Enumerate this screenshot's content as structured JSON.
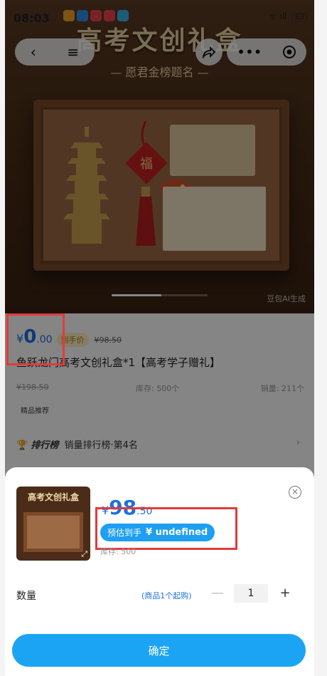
{
  "status_bar": {
    "time": "08:03",
    "battery": "83"
  },
  "hero": {
    "title": "高考文创礼盒",
    "subtitle": "— 愿君金榜题名 —",
    "ai_label": "豆包AI生成"
  },
  "nav": {
    "back_icon": "back-arrow-icon",
    "menu_icon": "menu-icon",
    "share_icon": "share-icon",
    "more_icon": "more-icon",
    "target_icon": "record-icon"
  },
  "product": {
    "price_symbol": "¥",
    "price_int": "0",
    "price_dec": ".00",
    "final_tag": "到手价",
    "old_price": "¥98.50",
    "title": "鱼跃龙门高考文创礼盒*1【高考学子赠礼】",
    "original_price": "¥198.50",
    "stock": "库存: 500个",
    "sales": "销量: 211个",
    "recommend": "精品推荐",
    "rank_brand": "排行榜",
    "rank_text": "销量排行榜·第4名",
    "rank_arrow": "›"
  },
  "sheet": {
    "thumb_title": "高考文创礼盒",
    "price_symbol": "¥",
    "price_int": "98",
    "price_dec": ".50",
    "est_label": "预估到手",
    "est_value": "¥ undefined",
    "stock": "库存: 500",
    "qty_label": "数量",
    "qty_note": "(商品1个起购)",
    "qty_minus": "—",
    "qty_value": "1",
    "qty_plus": "+",
    "confirm_label": "确定",
    "close_label": "×"
  },
  "colors": {
    "accent": "#1e6fe0",
    "button": "#1aa4f3",
    "highlight_box": "#e23b3b"
  }
}
